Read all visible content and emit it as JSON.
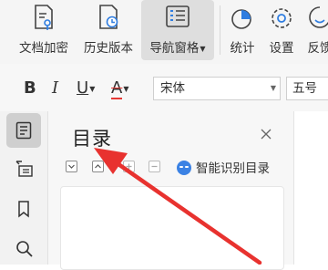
{
  "toolbar": {
    "items": [
      {
        "label": "文档加密",
        "icon": "document-lock-icon"
      },
      {
        "label": "历史版本",
        "icon": "document-history-icon"
      },
      {
        "label": "导航窗格",
        "icon": "navigation-pane-icon",
        "active": true,
        "has_dropdown": true
      },
      {
        "label": "统计",
        "icon": "pie-chart-icon"
      },
      {
        "label": "设置",
        "icon": "gear-icon"
      },
      {
        "label": "反馈",
        "icon": "smile-feedback-icon"
      }
    ]
  },
  "format": {
    "bold": "B",
    "italic": "I",
    "underline": "U",
    "strike_color": "A",
    "font_name": "宋体",
    "font_size": "五号",
    "strike_color_hex": "#e53935"
  },
  "sidebar": {
    "items": [
      {
        "icon": "outline-icon",
        "active": true
      },
      {
        "icon": "chapter-icon",
        "active": false
      },
      {
        "icon": "bookmark-icon",
        "active": false
      },
      {
        "icon": "search-icon",
        "active": false
      }
    ]
  },
  "panel": {
    "title": "目录",
    "smart_label": "智能识别目录"
  },
  "colors": {
    "accent": "#3b82e4",
    "annotation_arrow": "#e8322f"
  }
}
